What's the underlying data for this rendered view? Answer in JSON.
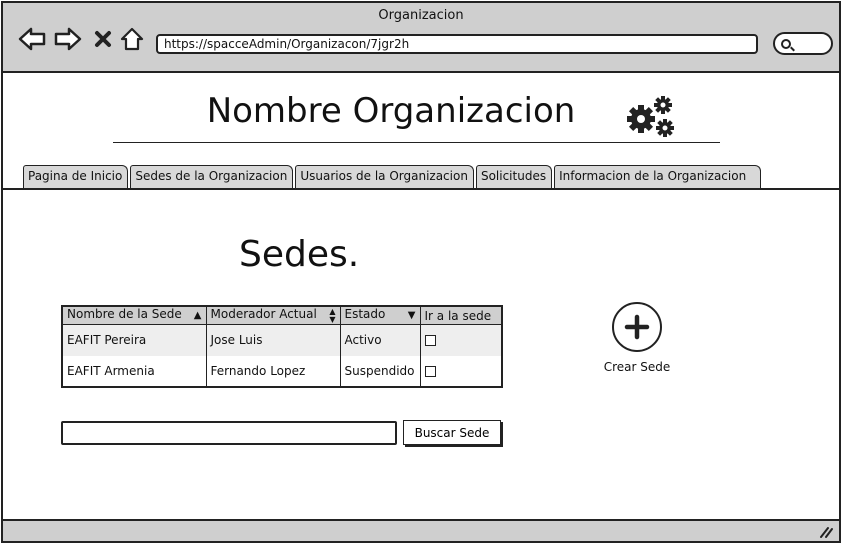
{
  "window": {
    "title": "Organizacion"
  },
  "browser": {
    "url": "https://spacceAdmin/Organizacon/7jgr2h",
    "icons": [
      "back-arrow-icon",
      "forward-arrow-icon",
      "close-icon",
      "home-icon",
      "search-icon"
    ]
  },
  "header": {
    "org_name": "Nombre Organizacion",
    "icon": "gears-icon"
  },
  "tabs": [
    {
      "label": "Pagina de Inicio"
    },
    {
      "label": "Sedes de la Organizacion"
    },
    {
      "label": "Usuarios de la Organizacion"
    },
    {
      "label": "Solicitudes"
    },
    {
      "label": "Informacion de la Organizacion"
    }
  ],
  "main": {
    "heading": "Sedes.",
    "table": {
      "columns": [
        {
          "label": "Nombre de la Sede",
          "sort": "asc"
        },
        {
          "label": "Moderador Actual",
          "sort": "both"
        },
        {
          "label": "Estado",
          "sort": "desc"
        },
        {
          "label": "Ir a la sede",
          "sort": "none"
        }
      ],
      "rows": [
        {
          "name": "EAFIT Pereira",
          "moderator": "Jose Luis",
          "status": "Activo",
          "go": false
        },
        {
          "name": "EAFIT Armenia",
          "moderator": "Fernando Lopez",
          "status": "Suspendido",
          "go": false
        }
      ]
    },
    "create_button": {
      "label": "Crear Sede",
      "icon": "plus-icon"
    },
    "search": {
      "value": "",
      "placeholder": "",
      "button_label": "Buscar Sede"
    }
  },
  "colors": {
    "chrome": "#cfcfcf",
    "row_alt": "#eeeeee",
    "ink": "#222222"
  }
}
